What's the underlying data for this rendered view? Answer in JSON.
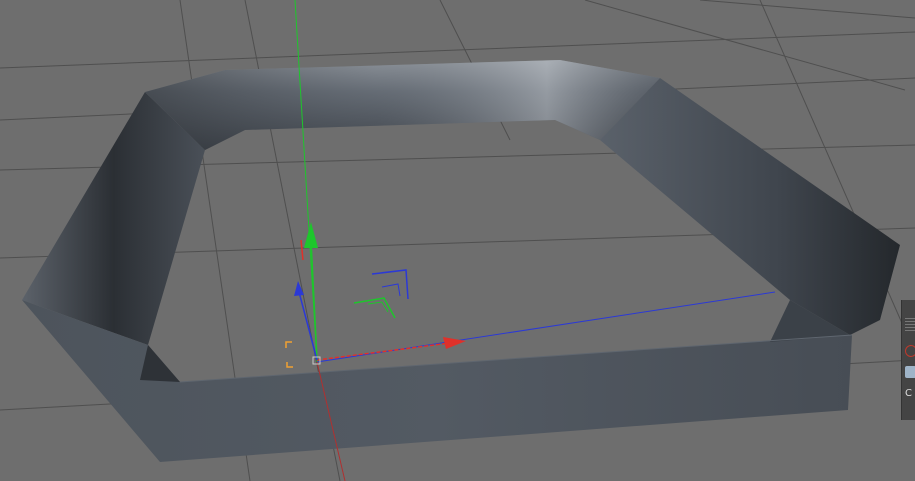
{
  "viewport": {
    "background_color": "#6e6e6e",
    "grid_color": "#4f4f4f",
    "object_type": "extruded-hexagon-ring",
    "object_color": "#4d535b"
  },
  "gizmo": {
    "x_axis_color": "#e0312a",
    "y_axis_color": "#1ec62c",
    "z_axis_color": "#2b39d6",
    "pivot_marker_color": "#f0a030"
  },
  "side_panel": {
    "icons": [
      "grip-icon",
      "record-icon",
      "color-swatch-icon"
    ],
    "letter_fragment": "C"
  }
}
